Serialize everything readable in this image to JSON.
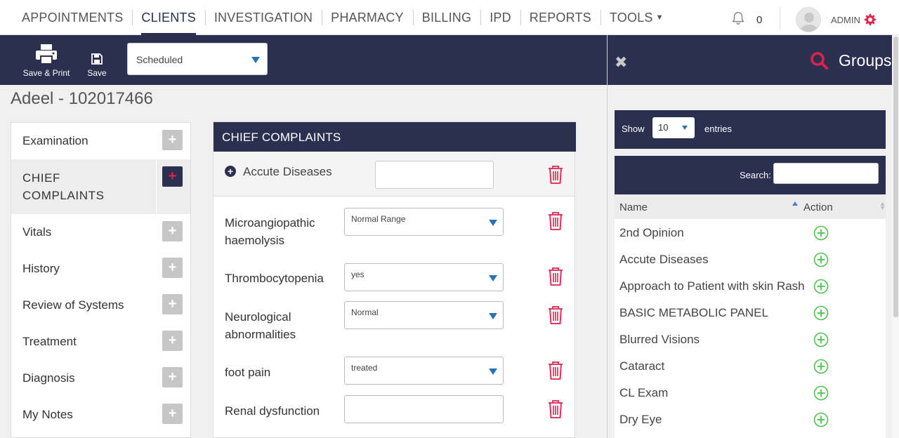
{
  "nav": {
    "items": [
      {
        "label": "APPOINTMENTS"
      },
      {
        "label": "CLIENTS"
      },
      {
        "label": "INVESTIGATION"
      },
      {
        "label": "PHARMACY"
      },
      {
        "label": "BILLING"
      },
      {
        "label": "IPD"
      },
      {
        "label": "REPORTS"
      },
      {
        "label": "TOOLS"
      }
    ],
    "active": "CLIENTS",
    "notification_count": "0",
    "user_label": "ADMIN"
  },
  "toolbar": {
    "save_print_label": "Save & Print",
    "save_label": "Save",
    "status_value": "Scheduled"
  },
  "patient": {
    "title": "Adeel - 102017466"
  },
  "sidebar": {
    "items": [
      {
        "label": "Examination"
      },
      {
        "label": "CHIEF COMPLAINTS"
      },
      {
        "label": "Vitals"
      },
      {
        "label": "History"
      },
      {
        "label": "Review of Systems"
      },
      {
        "label": "Treatment"
      },
      {
        "label": "Diagnosis"
      },
      {
        "label": "My Notes"
      }
    ],
    "active": "CHIEF COMPLAINTS"
  },
  "chief_complaints": {
    "header": "CHIEF COMPLAINTS",
    "add_row": {
      "label": "Accute Diseases",
      "value": ""
    },
    "rows": [
      {
        "label": "Microangiopathic haemolysis",
        "value": "Normal Range"
      },
      {
        "label": "Thrombocytopenia",
        "value": "yes"
      },
      {
        "label": "Neurological abnormalities",
        "value": "Normal"
      },
      {
        "label": "foot pain",
        "value": "treated"
      },
      {
        "label": "Renal dysfunction",
        "value": ""
      }
    ]
  },
  "groups_panel": {
    "title": "Groups",
    "show_label": "Show",
    "entries_value": "10",
    "entries_label": "entries",
    "search_label": "Search:",
    "search_value": "",
    "columns": {
      "name": "Name",
      "action": "Action"
    },
    "rows": [
      {
        "name": "2nd Opinion"
      },
      {
        "name": "Accute Diseases"
      },
      {
        "name": "Approach to Patient with skin Rash"
      },
      {
        "name": "BASIC METABOLIC PANEL"
      },
      {
        "name": "Blurred Visions"
      },
      {
        "name": "Cataract"
      },
      {
        "name": "CL Exam"
      },
      {
        "name": "Dry Eye"
      }
    ]
  },
  "colors": {
    "navy": "#2b3050",
    "accent_red": "#e0214d",
    "action_green": "#4cc34c"
  }
}
